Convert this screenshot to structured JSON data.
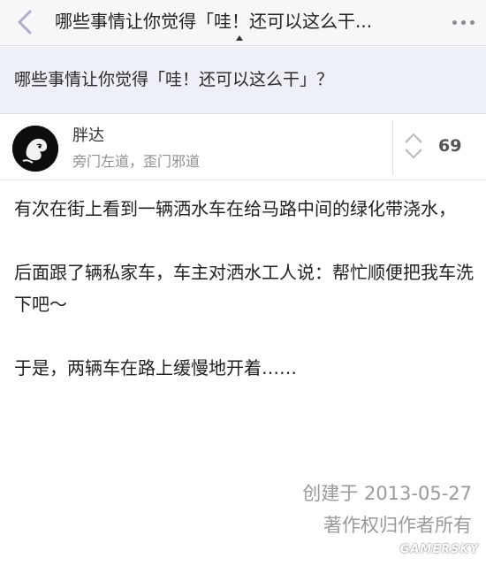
{
  "navbar": {
    "title": "哪些事情让你觉得「哇！还可以这么干...",
    "back_icon": "chevron-left-icon",
    "menu_icon": "more-horizontal-icon"
  },
  "question": {
    "title": "哪些事情让你觉得「哇！还可以这么干」？"
  },
  "answer": {
    "author": {
      "name": "胖达",
      "bio": "旁门左道，歪门邪道",
      "avatar_icon": "avatar"
    },
    "votes": {
      "count": "69",
      "icon": "vote-up-down-icon"
    },
    "paragraphs": [
      "有次在街上看到一辆洒水车在给马路中间的绿化带浇水，",
      "后面跟了辆私家车，车主对洒水工人说：帮忙顺便把我车洗下吧～",
      "于是，两辆车在路上缓慢地开着……"
    ],
    "created": "创建于 2013-05-27",
    "copyright": "著作权归作者所有"
  },
  "watermark": "GAMERSKY",
  "colors": {
    "navbar_bg": "#f7f7f9",
    "question_bg": "#eef0f7",
    "meta_text": "#9a9a9e",
    "back_icon": "#b3a9c9"
  }
}
